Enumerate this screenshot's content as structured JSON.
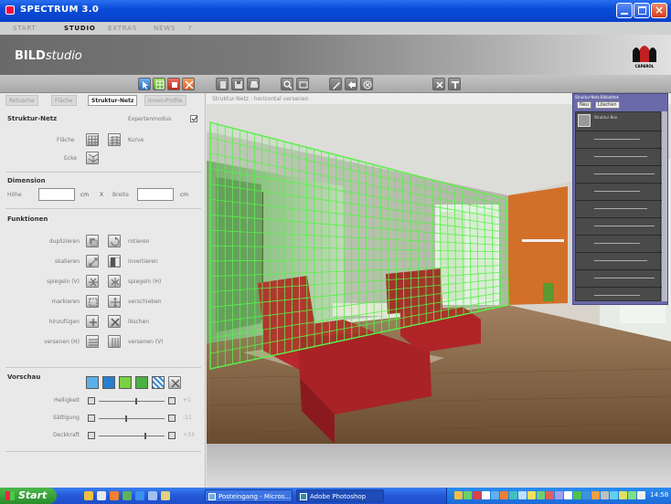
{
  "window": {
    "title": "SPECTRUM 3.0"
  },
  "menu": {
    "items": [
      "START",
      "STUDIO",
      "EXTRAS",
      "NEWS",
      "?"
    ],
    "active": "STUDIO"
  },
  "header": {
    "brand_bold": "BILD",
    "brand_italic": "studio",
    "logo_text": "CAPAROL"
  },
  "tabs": [
    "Retusche",
    "Fläche",
    "Struktur-Netz",
    "Innen-Profile"
  ],
  "active_tab": "Struktur-Netz",
  "breadcrumb": "Struktur-Netz : horizontal versenen",
  "struktur": {
    "title": "Struktur-Netz",
    "expert": "Expertenmodus",
    "flaeche": "Fläche",
    "kurve": "Kurve",
    "ecke": "Ecke"
  },
  "dimension": {
    "title": "Dimension",
    "hoehe": "Höhe",
    "unit1": "cm",
    "x": "X",
    "breite": "Breite",
    "unit2": "cm"
  },
  "funktionen": {
    "title": "Funktionen",
    "left": [
      "duplizieren",
      "skalieren",
      "spiegeln (V)",
      "markieren",
      "hinzufügen",
      "versenen (H)"
    ],
    "right": [
      "rotieren",
      "invertieren",
      "spiegeln (H)",
      "verschieben",
      "löschen",
      "versenen (V)"
    ]
  },
  "vorschau": {
    "title": "Vorschau",
    "sliders": [
      {
        "label": "Helligkeit",
        "value_text": "+1",
        "level": 0.55
      },
      {
        "label": "Sättigung",
        "value_text": "-11",
        "level": 0.4
      },
      {
        "label": "Deckkraft",
        "value_text": "+33",
        "level": 0.7
      }
    ],
    "swatch_colors": [
      "#5ab0e8",
      "#2a7ed0",
      "#7ad040",
      "#4ab040",
      "#3a8ad8"
    ]
  },
  "palette": {
    "title": "Struktur-Netz-Bibliothek",
    "btn1": "Neu",
    "btn2": "Löschen",
    "first_item": "Struktur Bez."
  },
  "taskbar": {
    "start": "Start",
    "tasks": [
      {
        "label": "Posteingang - Micros..."
      },
      {
        "label": "Adobe Photoshop"
      }
    ],
    "clock": "14:58"
  },
  "colors": {
    "grid": "#5af04a",
    "wall_orange": "#d2702a",
    "sofa": "#b8282c",
    "floor": "#8a6a4a"
  }
}
